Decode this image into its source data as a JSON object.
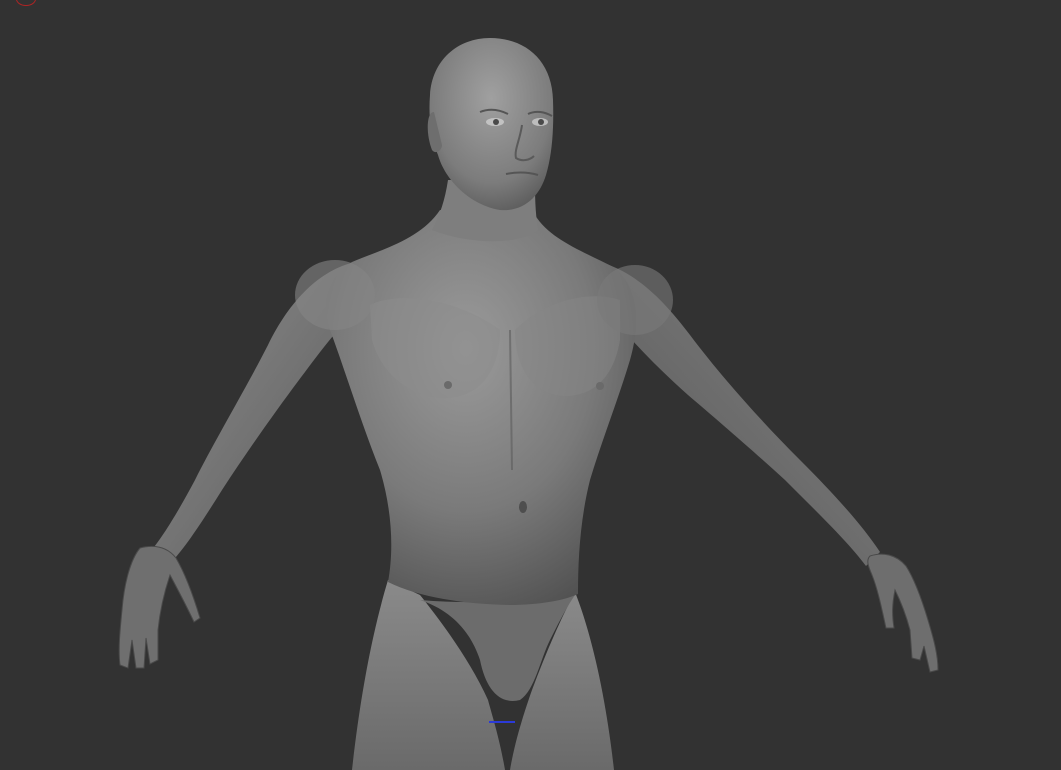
{
  "viewport": {
    "background_color": "#323232",
    "model_color": "#7a7a7a",
    "model_highlight_color": "#9b9b9b",
    "model_shadow_color": "#4a4a4a",
    "icons": {
      "corner_marker": "red-circle-icon",
      "gizmo": "blue-axis-icon"
    },
    "marker_color": "#b02424",
    "gizmo_color": "#2b3ad8"
  }
}
